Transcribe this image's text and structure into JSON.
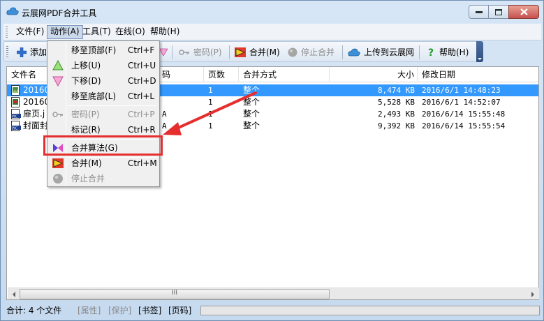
{
  "window": {
    "title": "云展网PDF合并工具"
  },
  "menubar": {
    "items": [
      {
        "label": "文件(F)",
        "active": false
      },
      {
        "label": "动作(A)",
        "active": true
      },
      {
        "label": "工具(T)",
        "active": false
      },
      {
        "label": "在线(O)",
        "active": false
      },
      {
        "label": "帮助(H)",
        "active": false
      }
    ]
  },
  "toolbar": {
    "add_label": "添加",
    "password_label": "密码(P)",
    "merge_label": "合并(M)",
    "stop_label": "停止合并",
    "upload_label": "上传到云展网",
    "help_label": "帮助(H)"
  },
  "list": {
    "columns": [
      "文件名",
      "码",
      "页数",
      "合并方式",
      "大小",
      "修改日期"
    ],
    "rows": [
      {
        "name": "201606",
        "pw": "",
        "pages": "1",
        "method": "整个",
        "size": "8,474 KB",
        "date": "2016/6/1 14:48:23",
        "selected": true
      },
      {
        "name": "201606",
        "pw": "",
        "pages": "1",
        "method": "整个",
        "size": "5,528 KB",
        "date": "2016/6/1 14:52:07",
        "selected": false
      },
      {
        "name": "扉页.j",
        "pw": "A",
        "pages": "1",
        "method": "整个",
        "size": "2,493 KB",
        "date": "2016/6/14 15:55:48",
        "selected": false
      },
      {
        "name": "封面封",
        "pw": "A",
        "pages": "1",
        "method": "整个",
        "size": "9,392 KB",
        "date": "2016/6/14 15:55:54",
        "selected": false
      }
    ]
  },
  "scrollbar": {
    "grip": "III"
  },
  "statusbar": {
    "total": "合计: 4 个文件",
    "props": "[属性]",
    "protect": "[保护]",
    "bookmark": "[书签]",
    "pagenum": "[页码]"
  },
  "dropdown": {
    "items": [
      {
        "label": "移至顶部(F)",
        "shortcut": "Ctrl+F",
        "icon": "none",
        "disabled": false
      },
      {
        "label": "上移(U)",
        "shortcut": "Ctrl+U",
        "icon": "triangle-up-icon",
        "disabled": false
      },
      {
        "label": "下移(D)",
        "shortcut": "Ctrl+D",
        "icon": "triangle-down-icon",
        "disabled": false
      },
      {
        "label": "移至底部(L)",
        "shortcut": "Ctrl+L",
        "icon": "none",
        "disabled": false
      },
      {
        "label": "密码(P)",
        "shortcut": "Ctrl+P",
        "icon": "key-icon",
        "disabled": true
      },
      {
        "label": "标记(R)",
        "shortcut": "Ctrl+R",
        "icon": "none",
        "disabled": false
      },
      {
        "label": "合并算法(G)",
        "shortcut": "",
        "icon": "bowtie-icon",
        "disabled": false
      },
      {
        "label": "合并(M)",
        "shortcut": "Ctrl+M",
        "icon": "merge-icon",
        "disabled": false
      },
      {
        "label": "停止合并",
        "shortcut": "",
        "icon": "stop-circle-icon",
        "disabled": true
      }
    ]
  },
  "colors": {
    "selection": "#3399ff",
    "annotation": "#e62e2e"
  }
}
